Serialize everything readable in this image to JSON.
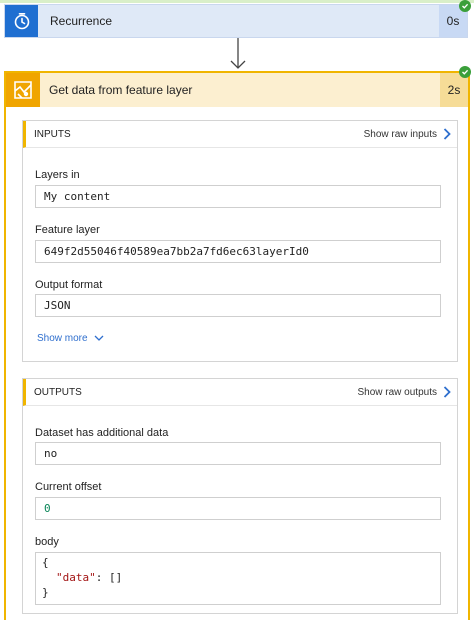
{
  "recurrence": {
    "title": "Recurrence",
    "duration": "0s"
  },
  "step": {
    "title": "Get data from feature layer",
    "duration": "2s",
    "inputs": {
      "header": "INPUTS",
      "raw_link": "Show raw inputs",
      "fields": [
        {
          "label": "Layers in",
          "value": "My content"
        },
        {
          "label": "Feature layer",
          "value": "649f2d55046f40589ea7bb2a7fd6ec63layerId0"
        },
        {
          "label": "Output format",
          "value": "JSON"
        }
      ],
      "show_more": "Show more"
    },
    "outputs": {
      "header": "OUTPUTS",
      "raw_link": "Show raw outputs",
      "fields": [
        {
          "label": "Dataset has additional data",
          "value": "no"
        },
        {
          "label": "Current offset",
          "value": "0"
        }
      ],
      "body_label": "body",
      "body_lines": {
        "open": "{",
        "key": "\"data\"",
        "colon": ": ",
        "val": "[]",
        "close": "}"
      }
    }
  },
  "colors": {
    "recurrence_accent": "#1f6fd1",
    "step_accent": "#f0a500",
    "success": "#3a9f3a",
    "link": "#2f6fce"
  }
}
